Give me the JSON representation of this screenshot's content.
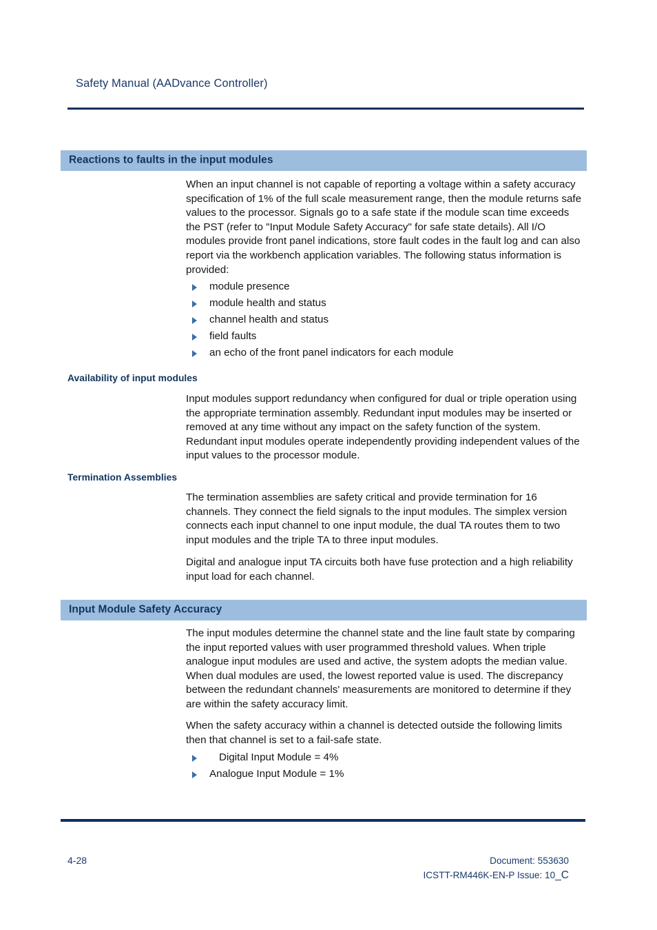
{
  "header": {
    "running_title": "Safety Manual (AADvance Controller)"
  },
  "sections": {
    "reactions": {
      "banner_title": "Reactions to faults in the input modules",
      "paragraph": "When an input channel is not capable of reporting a voltage within a safety accuracy specification of 1% of the full scale measurement range, then the module returns safe values to the processor. Signals go to a safe state if the module scan time exceeds the PST (refer to \"Input Module Safety Accuracy\" for safe state details). All I/O modules provide front panel indications, store fault codes in the fault log and can also report via the workbench application variables. The following status information is provided:",
      "bullets": [
        "module presence",
        "module health and status",
        "channel health and status",
        "field faults",
        "an echo of the front panel indicators for each module"
      ]
    },
    "availability": {
      "subheading": "Availability of input modules",
      "paragraph": "Input modules support redundancy when configured for dual or triple operation using the appropriate termination assembly. Redundant input modules may be inserted or removed at any time without any impact on the safety function of the system. Redundant input modules operate independently providing independent values of the input values to the processor module."
    },
    "termination": {
      "subheading": "Termination Assemblies",
      "paragraph1": "The termination assemblies are safety critical and provide termination for 16 channels. They connect the field signals to the input modules. The simplex version connects each input channel to one input module, the dual TA routes them to two input modules and the triple TA to three input modules.",
      "paragraph2": "Digital and analogue input TA circuits both have fuse protection and a high reliability input load for each channel."
    },
    "accuracy": {
      "banner_title": "Input Module Safety Accuracy",
      "paragraph1": "The input modules determine the channel state and the line fault state by comparing the input reported values with user programmed threshold values. When triple analogue input modules are used and active, the system adopts the median value. When dual modules are used, the lowest reported value is used. The discrepancy between the redundant channels' measurements are monitored to determine if they are within the safety accuracy limit.",
      "paragraph2": "When the safety accuracy within a channel is detected outside the following limits then that channel is set to a fail-safe state.",
      "bullets": [
        "Digital Input Module = 4%",
        "Analogue Input Module = 1%"
      ]
    }
  },
  "footer": {
    "page_number": "4-28",
    "document_line": "Document: 553630",
    "issue_prefix": "ICSTT-RM446K-EN-P Issue: 10",
    "issue_suffix": "_C"
  },
  "colors": {
    "banner_background": "#9dbddf",
    "heading_navy": "#12355e",
    "rule_navy": "#05305f",
    "bullet_blue": "#3a6ea5",
    "body_text": "#161616"
  }
}
